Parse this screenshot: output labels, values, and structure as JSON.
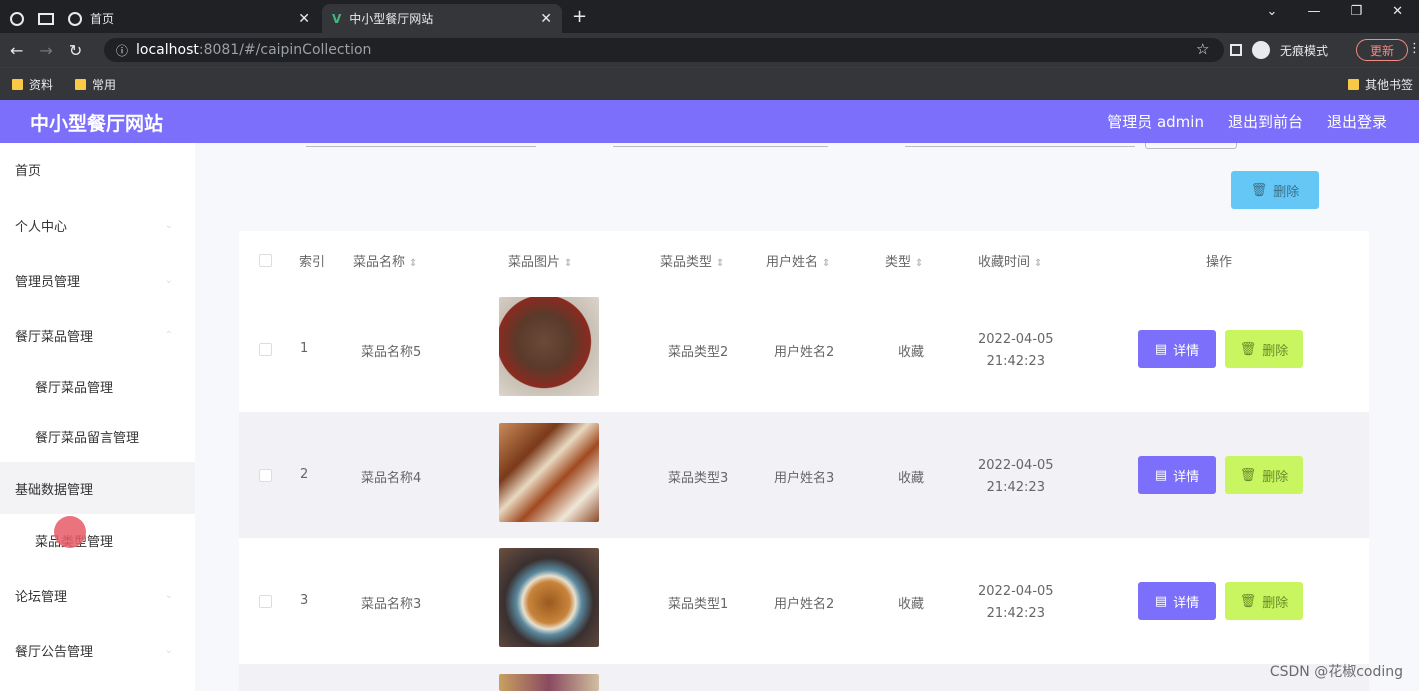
{
  "browser": {
    "tabs": [
      {
        "label": "首页",
        "active": false
      },
      {
        "label": "中小型餐厅网站",
        "active": true
      }
    ],
    "url_host": "localhost",
    "url_path": ":8081/#/caipinCollection",
    "incognito_label": "无痕模式",
    "update_label": "更新",
    "bookmarks": [
      "资料",
      "常用"
    ],
    "other_bookmarks": "其他书签"
  },
  "header": {
    "brand": "中小型餐厅网站",
    "admin_label": "管理员 admin",
    "front_label": "退出到前台",
    "logout_label": "退出登录"
  },
  "sidebar": {
    "items": [
      {
        "label": "首页"
      },
      {
        "label": "个人中心"
      },
      {
        "label": "管理员管理"
      },
      {
        "label": "餐厅菜品管理"
      },
      {
        "label": "餐厅菜品管理"
      },
      {
        "label": "餐厅菜品留言管理"
      },
      {
        "label": "基础数据管理"
      },
      {
        "label": "菜品类型管理"
      },
      {
        "label": "论坛管理"
      },
      {
        "label": "餐厅公告管理"
      }
    ]
  },
  "toolbar": {
    "delete_label": "删除"
  },
  "table": {
    "columns": [
      "索引",
      "菜品名称",
      "菜品图片",
      "菜品类型",
      "用户姓名",
      "类型",
      "收藏时间",
      "操作"
    ],
    "rows": [
      {
        "index": "1",
        "name": "菜品名称5",
        "type": "菜品类型2",
        "user": "用户姓名2",
        "kind": "收藏",
        "date": "2022-04-05",
        "time": "21:42:23",
        "img": "steak"
      },
      {
        "index": "2",
        "name": "菜品名称4",
        "type": "菜品类型3",
        "user": "用户姓名3",
        "kind": "收藏",
        "date": "2022-04-05",
        "time": "21:42:23",
        "img": "ribs"
      },
      {
        "index": "3",
        "name": "菜品名称3",
        "type": "菜品类型1",
        "user": "用户姓名2",
        "kind": "收藏",
        "date": "2022-04-05",
        "time": "21:42:23",
        "img": "noodles"
      }
    ],
    "detail_label": "详情",
    "delete_label": "删除"
  },
  "watermark": "CSDN @花椒coding"
}
